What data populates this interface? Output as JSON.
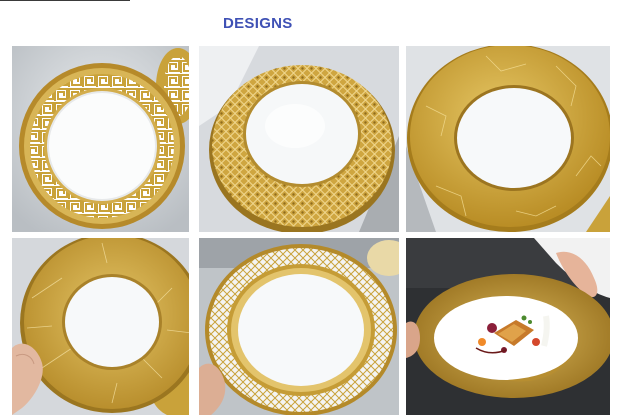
{
  "header": {
    "title": "DESIGNS"
  },
  "colors": {
    "title": "#3f51b5",
    "gold": "#c9a23a",
    "gold_dark": "#8a6a1c",
    "gold_light": "#e8cf86",
    "porcelain": "#f7f9fa",
    "backdrop_light": "#e6e9ec",
    "backdrop_dark": "#2f3134"
  },
  "gallery": {
    "photos": [
      {
        "name": "greek-key-gold-rim-plate",
        "icon": "plate-greek-key-icon"
      },
      {
        "name": "gold-lattice-rim-plate",
        "icon": "plate-lattice-icon"
      },
      {
        "name": "gold-crackle-wide-rim-plate",
        "icon": "plate-crackle-icon"
      },
      {
        "name": "gold-crackle-rim-plate-held",
        "icon": "plate-crackle-held-icon"
      },
      {
        "name": "white-lattice-gold-band-plate",
        "icon": "plate-white-lattice-icon"
      },
      {
        "name": "gold-rim-plate-with-plated-food",
        "icon": "plated-food-icon"
      }
    ]
  }
}
